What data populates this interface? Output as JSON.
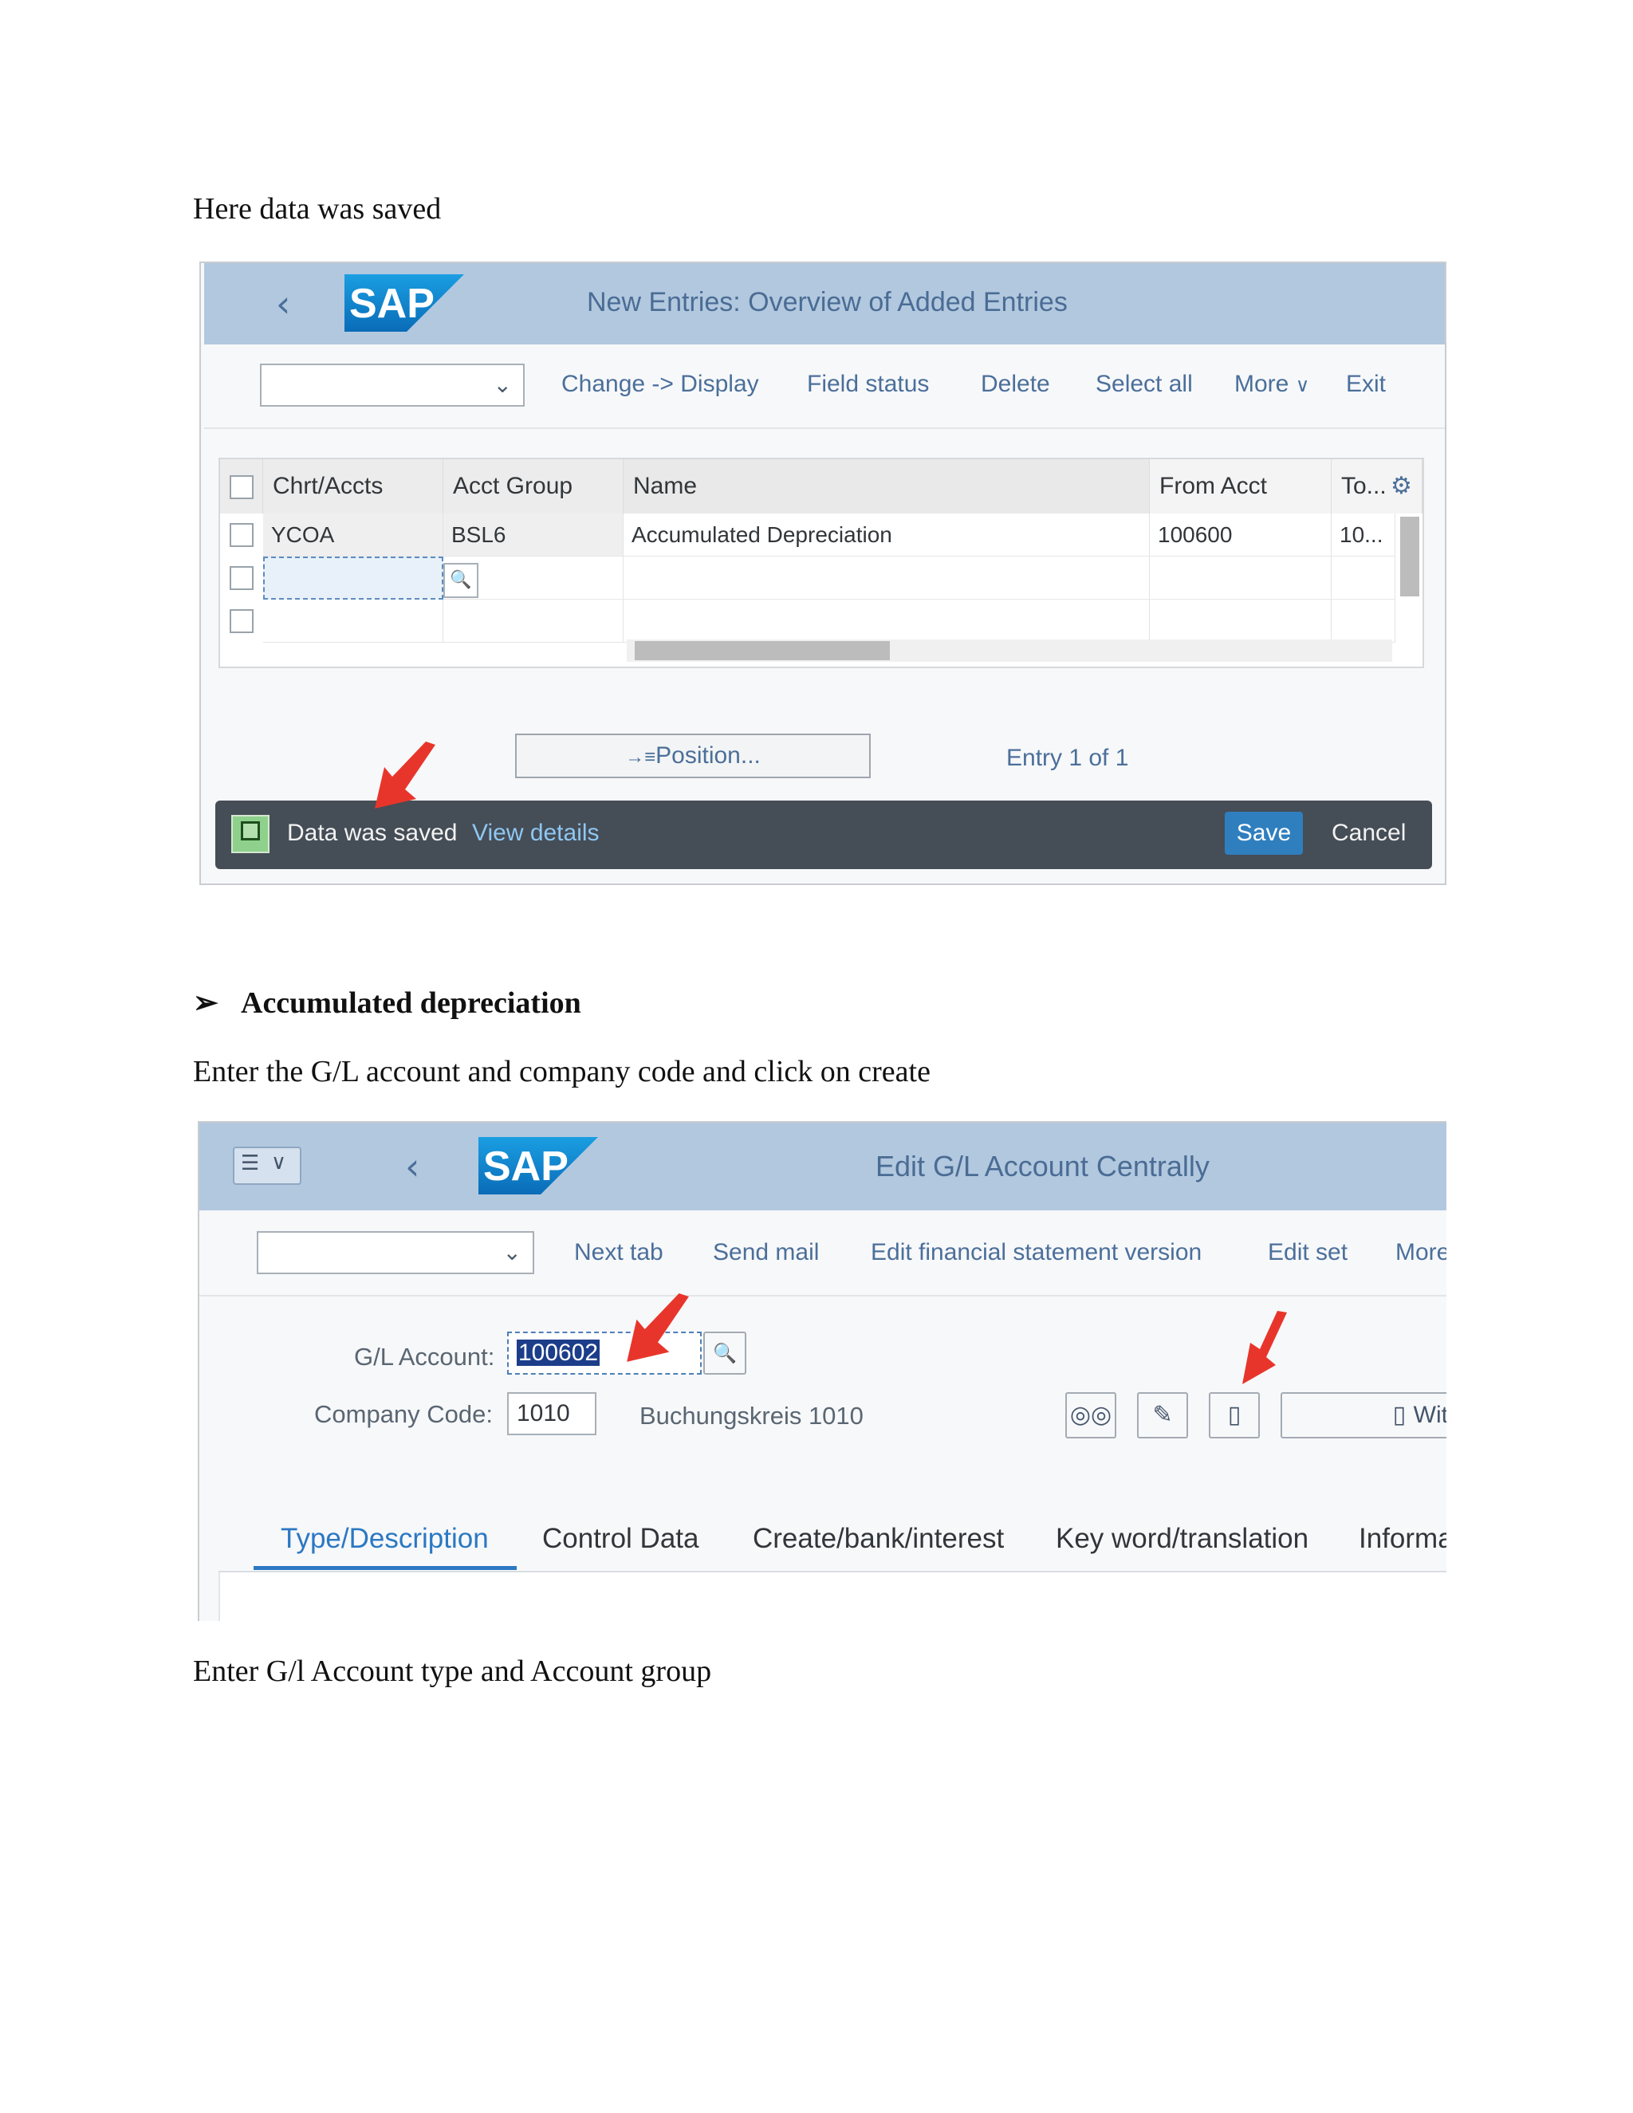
{
  "captions": {
    "intro": "Here data was saved",
    "section_heading": "Accumulated depreciation",
    "instruction_1": "Enter the G/L account and company code and click on create",
    "instruction_2": "Enter G/l Account type and Account group"
  },
  "screen1": {
    "logo_text": "SAP",
    "title": "New Entries: Overview of Added Entries",
    "toolbar": [
      "Change -> Display",
      "Field status",
      "Delete",
      "Select all",
      "More",
      "Exit"
    ],
    "table": {
      "columns": [
        "Chrt/Accts",
        "Acct Group",
        "Name",
        "From Acct",
        "To..."
      ],
      "rows": [
        [
          "YCOA",
          "BSL6",
          "Accumulated Depreciation",
          "100600",
          "10..."
        ]
      ]
    },
    "position_button": "Position...",
    "entry_text": "Entry 1 of 1",
    "message": {
      "text": "Data was saved",
      "link": "View details",
      "save": "Save",
      "cancel": "Cancel"
    }
  },
  "screen2": {
    "logo_text": "SAP",
    "title": "Edit G/L Account Centrally",
    "toolbar": [
      "Next tab",
      "Send mail",
      "Edit financial statement version",
      "Edit set",
      "More"
    ],
    "gl_account_label": "G/L Account:",
    "gl_account_value": "100602",
    "company_code_label": "Company Code:",
    "company_code_value": "1010",
    "company_code_desc": "Buchungskreis 1010",
    "with_template_label": "Wit",
    "tabs": [
      "Type/Description",
      "Control Data",
      "Create/bank/interest",
      "Key word/translation",
      "Informa"
    ],
    "active_tab": "Type/Description"
  },
  "colors": {
    "shellbar": "#b2c8df",
    "link_blue": "#4b6f9a",
    "message_bar": "#454d56",
    "save_button": "#2f7fbf",
    "success_green": "#8fd18c",
    "annotation_red": "#e8352b"
  }
}
